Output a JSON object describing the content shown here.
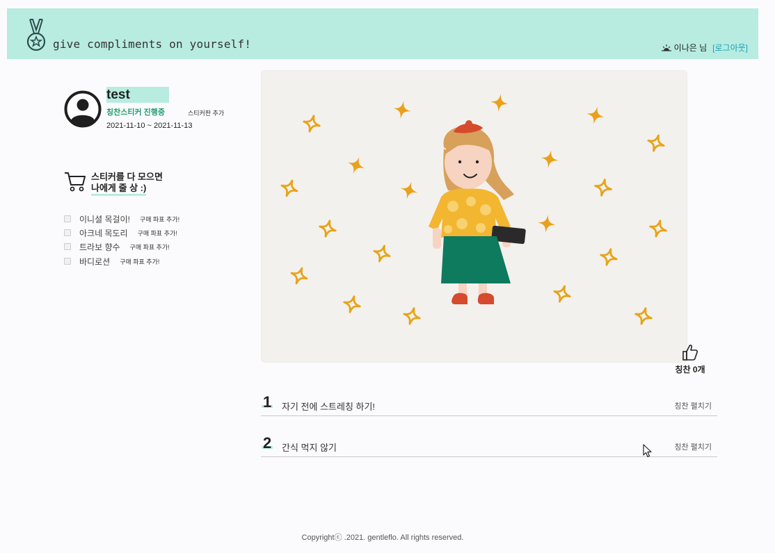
{
  "header": {
    "site_title": "give compliments on yourself!",
    "user_name": "이나은 님",
    "logout_label": "[로그아웃]",
    "logo_icon": "medal-icon",
    "user_icon": "sun-icon",
    "accent_color": "#b8ece0",
    "link_color": "#17a2b8"
  },
  "profile": {
    "name": "test",
    "status": "칭찬스티커 진행중",
    "add_board_label": "스티커판 추가",
    "dates": "2021-11-10 ~ 2021-11-13",
    "avatar_icon": "user-avatar-icon"
  },
  "reward": {
    "line1": "스티커를 다 모으면",
    "line2": "나에게 줄 상 :)",
    "icon": "cart-icon"
  },
  "wishlist": [
    {
      "label": "이니셜 목걸이!",
      "action": "구매 파표 추가!",
      "checked": false
    },
    {
      "label": "아크네 목도리",
      "action": "구매 파표 추가!",
      "checked": false
    },
    {
      "label": "트라보 향수",
      "action": "구매 파표 추가!",
      "checked": false
    },
    {
      "label": "바디로션",
      "action": "구매 파표 추가!",
      "checked": false
    }
  ],
  "like": {
    "icon": "thumbs-up-icon",
    "prefix": "칭찬 ",
    "count": "0",
    "suffix": "개"
  },
  "tasks": [
    {
      "number": "1",
      "text": "자기 전에 스트레칭 하기!",
      "button": "칭찬 펼치기"
    },
    {
      "number": "2",
      "text": "간식 먹지 않기",
      "button": "칭찬 펼치기"
    }
  ],
  "footer": {
    "copyright": "Copyrightⓒ .2021. gentleflo. All rights reserved."
  }
}
